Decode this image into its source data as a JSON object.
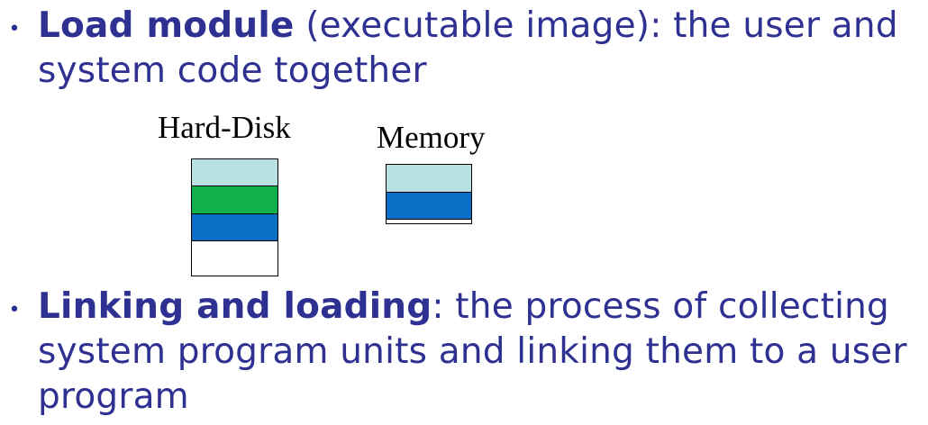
{
  "bullets": [
    {
      "marker": "•",
      "term": "Load module",
      "text": " (executable image): the user and system code together"
    },
    {
      "marker": "•",
      "term": "Linking and loading",
      "text": ": the process of collecting system program units and linking them to a user program"
    }
  ],
  "diagram": {
    "disk_label": "Hard-Disk",
    "memory_label": "Memory",
    "colors": {
      "light_blue": "#b9e0e3",
      "green": "#10b04c",
      "blue": "#0b6fc6",
      "white": "#ffffff"
    }
  }
}
